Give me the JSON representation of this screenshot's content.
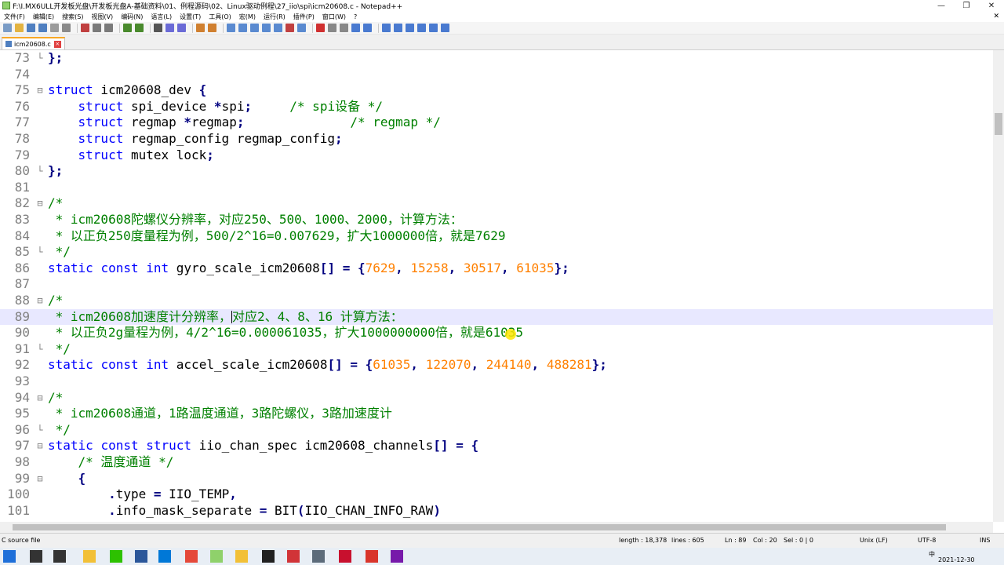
{
  "window": {
    "title": "F:\\I.MX6ULL开发板光盘\\开发板光盘A-基础资料\\01、例程源码\\02、Linux驱动例程\\27_iio\\spi\\icm20608.c - Notepad++",
    "minimize": "—",
    "maximize": "❐",
    "close": "✕"
  },
  "menu": [
    "文件(F)",
    "编辑(E)",
    "搜索(S)",
    "视图(V)",
    "编码(N)",
    "语言(L)",
    "设置(T)",
    "工具(O)",
    "宏(M)",
    "运行(R)",
    "插件(P)",
    "窗口(W)",
    "?"
  ],
  "menu_close": "✕",
  "tab": {
    "label": "icm20608.c",
    "close": "×"
  },
  "code_lines": [
    {
      "n": "73",
      "fold": "└",
      "tokens": [
        {
          "t": "};",
          "c": "op"
        }
      ]
    },
    {
      "n": "74",
      "fold": "",
      "tokens": []
    },
    {
      "n": "75",
      "fold": "⊟",
      "tokens": [
        {
          "t": "struct",
          "c": "kw"
        },
        {
          "t": " icm20608_dev ",
          "c": ""
        },
        {
          "t": "{",
          "c": "op"
        }
      ]
    },
    {
      "n": "76",
      "fold": "",
      "tokens": [
        {
          "t": "    ",
          "c": ""
        },
        {
          "t": "struct",
          "c": "kw"
        },
        {
          "t": " spi_device ",
          "c": ""
        },
        {
          "t": "*",
          "c": "op"
        },
        {
          "t": "spi",
          "c": ""
        },
        {
          "t": ";",
          "c": "op"
        },
        {
          "t": "     ",
          "c": ""
        },
        {
          "t": "/* spi设备 */",
          "c": "cm"
        }
      ]
    },
    {
      "n": "77",
      "fold": "",
      "tokens": [
        {
          "t": "    ",
          "c": ""
        },
        {
          "t": "struct",
          "c": "kw"
        },
        {
          "t": " regmap ",
          "c": ""
        },
        {
          "t": "*",
          "c": "op"
        },
        {
          "t": "regmap",
          "c": ""
        },
        {
          "t": ";",
          "c": "op"
        },
        {
          "t": "              ",
          "c": ""
        },
        {
          "t": "/* regmap */",
          "c": "cm"
        }
      ]
    },
    {
      "n": "78",
      "fold": "",
      "tokens": [
        {
          "t": "    ",
          "c": ""
        },
        {
          "t": "struct",
          "c": "kw"
        },
        {
          "t": " regmap_config regmap_config",
          "c": ""
        },
        {
          "t": ";",
          "c": "op"
        }
      ]
    },
    {
      "n": "79",
      "fold": "",
      "tokens": [
        {
          "t": "    ",
          "c": ""
        },
        {
          "t": "struct",
          "c": "kw"
        },
        {
          "t": " mutex lock",
          "c": ""
        },
        {
          "t": ";",
          "c": "op"
        }
      ]
    },
    {
      "n": "80",
      "fold": "└",
      "tokens": [
        {
          "t": "};",
          "c": "op"
        }
      ]
    },
    {
      "n": "81",
      "fold": "",
      "tokens": []
    },
    {
      "n": "82",
      "fold": "⊟",
      "tokens": [
        {
          "t": "/*",
          "c": "cm"
        }
      ]
    },
    {
      "n": "83",
      "fold": "",
      "tokens": [
        {
          "t": " * icm20608陀螺仪分辨率，对应250、500、1000、2000，计算方法：",
          "c": "cm"
        }
      ]
    },
    {
      "n": "84",
      "fold": "",
      "tokens": [
        {
          "t": " * 以正负250度量程为例，500/2^16=0.007629，扩大1000000倍，就是7629",
          "c": "cm"
        }
      ]
    },
    {
      "n": "85",
      "fold": "└",
      "tokens": [
        {
          "t": " */",
          "c": "cm"
        }
      ]
    },
    {
      "n": "86",
      "fold": "",
      "tokens": [
        {
          "t": "static",
          "c": "kw"
        },
        {
          "t": " ",
          "c": ""
        },
        {
          "t": "const",
          "c": "kw"
        },
        {
          "t": " ",
          "c": ""
        },
        {
          "t": "int",
          "c": "kw"
        },
        {
          "t": " gyro_scale_icm20608",
          "c": ""
        },
        {
          "t": "[] = {",
          "c": "op"
        },
        {
          "t": "7629",
          "c": "num"
        },
        {
          "t": ", ",
          "c": "op"
        },
        {
          "t": "15258",
          "c": "num"
        },
        {
          "t": ", ",
          "c": "op"
        },
        {
          "t": "30517",
          "c": "num"
        },
        {
          "t": ", ",
          "c": "op"
        },
        {
          "t": "61035",
          "c": "num"
        },
        {
          "t": "};",
          "c": "op"
        }
      ]
    },
    {
      "n": "87",
      "fold": "",
      "tokens": []
    },
    {
      "n": "88",
      "fold": "⊟",
      "tokens": [
        {
          "t": "/*",
          "c": "cm"
        }
      ]
    },
    {
      "n": "89",
      "fold": "",
      "cur": true,
      "tokens": [
        {
          "t": " * icm20608加速度计分辨率，",
          "c": "cm"
        },
        {
          "t": "|",
          "c": "caret"
        },
        {
          "t": "对应2、4、8、16 计算方法：",
          "c": "cm"
        }
      ]
    },
    {
      "n": "90",
      "fold": "",
      "tokens": [
        {
          "t": " * 以正负2g量程为例，4/2^16=0.000061035，扩大1000000000倍，就是61035",
          "c": "cm"
        }
      ]
    },
    {
      "n": "91",
      "fold": "└",
      "tokens": [
        {
          "t": " */",
          "c": "cm"
        }
      ]
    },
    {
      "n": "92",
      "fold": "",
      "tokens": [
        {
          "t": "static",
          "c": "kw"
        },
        {
          "t": " ",
          "c": ""
        },
        {
          "t": "const",
          "c": "kw"
        },
        {
          "t": " ",
          "c": ""
        },
        {
          "t": "int",
          "c": "kw"
        },
        {
          "t": " accel_scale_icm20608",
          "c": ""
        },
        {
          "t": "[] = {",
          "c": "op"
        },
        {
          "t": "61035",
          "c": "num"
        },
        {
          "t": ", ",
          "c": "op"
        },
        {
          "t": "122070",
          "c": "num"
        },
        {
          "t": ", ",
          "c": "op"
        },
        {
          "t": "244140",
          "c": "num"
        },
        {
          "t": ", ",
          "c": "op"
        },
        {
          "t": "488281",
          "c": "num"
        },
        {
          "t": "};",
          "c": "op"
        }
      ]
    },
    {
      "n": "93",
      "fold": "",
      "tokens": []
    },
    {
      "n": "94",
      "fold": "⊟",
      "tokens": [
        {
          "t": "/*",
          "c": "cm"
        }
      ]
    },
    {
      "n": "95",
      "fold": "",
      "tokens": [
        {
          "t": " * icm20608通道，1路温度通道，3路陀螺仪，3路加速度计",
          "c": "cm"
        }
      ]
    },
    {
      "n": "96",
      "fold": "└",
      "tokens": [
        {
          "t": " */",
          "c": "cm"
        }
      ]
    },
    {
      "n": "97",
      "fold": "⊟",
      "tokens": [
        {
          "t": "static",
          "c": "kw"
        },
        {
          "t": " ",
          "c": ""
        },
        {
          "t": "const",
          "c": "kw"
        },
        {
          "t": " ",
          "c": ""
        },
        {
          "t": "struct",
          "c": "kw"
        },
        {
          "t": " iio_chan_spec icm20608_channels",
          "c": ""
        },
        {
          "t": "[] = {",
          "c": "op"
        }
      ]
    },
    {
      "n": "98",
      "fold": "",
      "tokens": [
        {
          "t": "    ",
          "c": ""
        },
        {
          "t": "/* 温度通道 */",
          "c": "cm"
        }
      ]
    },
    {
      "n": "99",
      "fold": "⊟",
      "tokens": [
        {
          "t": "    ",
          "c": ""
        },
        {
          "t": "{",
          "c": "op"
        }
      ]
    },
    {
      "n": "100",
      "fold": "",
      "tokens": [
        {
          "t": "        ",
          "c": ""
        },
        {
          "t": ".",
          "c": "op"
        },
        {
          "t": "type ",
          "c": ""
        },
        {
          "t": "=",
          "c": "op"
        },
        {
          "t": " IIO_TEMP",
          "c": ""
        },
        {
          "t": ",",
          "c": "op"
        }
      ]
    },
    {
      "n": "101",
      "fold": "",
      "tokens": [
        {
          "t": "        ",
          "c": ""
        },
        {
          "t": ".",
          "c": "op"
        },
        {
          "t": "info_mask_separate ",
          "c": ""
        },
        {
          "t": "=",
          "c": "op"
        },
        {
          "t": " BIT",
          "c": ""
        },
        {
          "t": "(",
          "c": "op"
        },
        {
          "t": "IIO_CHAN_INFO_RAW",
          "c": ""
        },
        {
          "t": ")",
          "c": "op"
        }
      ]
    }
  ],
  "status": {
    "lang": "C source file",
    "length": "length : 18,378",
    "lines": "lines : 605",
    "ln": "Ln : 89",
    "col": "Col : 20",
    "sel": "Sel : 0 | 0",
    "eol": "Unix (LF)",
    "enc": "UTF-8",
    "ins": "INS"
  },
  "taskbar": {
    "ime": "中",
    "date": "2021-12-30",
    "apps": [
      {
        "name": "start-icon",
        "color": "#1e6fd9"
      },
      {
        "name": "search-icon",
        "color": "#333333"
      },
      {
        "name": "task-view-icon",
        "color": "#333333"
      },
      {
        "name": "file-explorer-icon",
        "color": "#f2c037"
      },
      {
        "name": "wechat-icon",
        "color": "#2dc100"
      },
      {
        "name": "word-icon",
        "color": "#2b579a"
      },
      {
        "name": "vscode-icon",
        "color": "#0078d7"
      },
      {
        "name": "chrome-icon",
        "color": "#e5493a"
      },
      {
        "name": "notepadpp-icon",
        "color": "#8fd16b"
      },
      {
        "name": "folder-icon",
        "color": "#f2c037"
      },
      {
        "name": "terminal-icon",
        "color": "#202020"
      },
      {
        "name": "foxit-icon",
        "color": "#d13438"
      },
      {
        "name": "calculator-icon",
        "color": "#5c6b7a"
      },
      {
        "name": "app-red-icon",
        "color": "#c8102e"
      },
      {
        "name": "recorder-icon",
        "color": "#d9352b"
      },
      {
        "name": "onenote-icon",
        "color": "#7719aa"
      }
    ]
  },
  "colors": {
    "keyword": "#0000ff",
    "number": "#ff8000",
    "comment": "#008000",
    "operator": "#000080",
    "current_line": "#e8e8ff"
  }
}
